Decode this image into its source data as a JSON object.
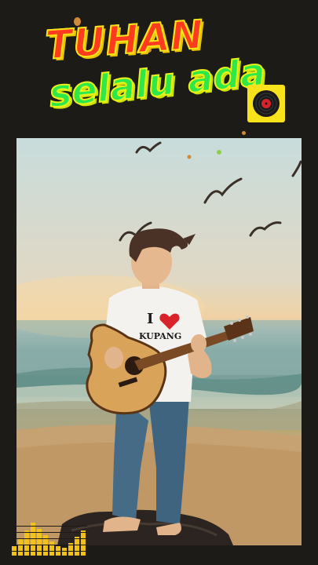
{
  "title": {
    "line1": "TUHAN",
    "line2": "selalu ada"
  },
  "shirt_text": {
    "letter": "I",
    "place": "KUPANG"
  },
  "icons": {
    "record": "vinyl-record-icon",
    "equalizer": "equalizer-icon"
  },
  "colors": {
    "background": "#1c1b18",
    "title_line1": "#ff3b1f",
    "title_line2": "#2ee84a",
    "title_outline": "#f7e31a",
    "record_bg": "#f7e21c",
    "equalizer": "#f2c21a"
  }
}
